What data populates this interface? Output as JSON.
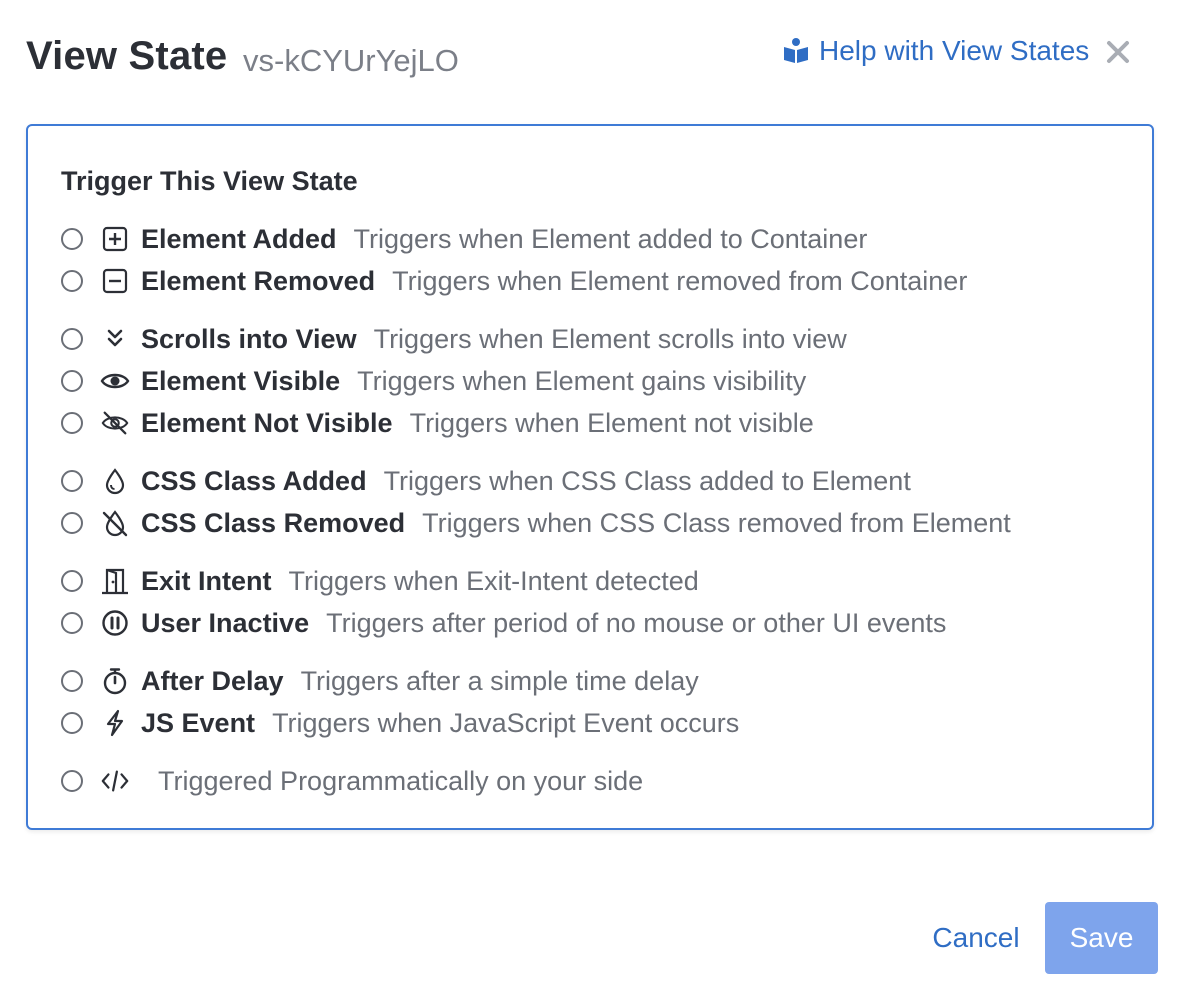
{
  "dialog": {
    "title": "View State",
    "subtitle": "vs-kCYUrYejLO",
    "help_link": "Help with View States",
    "close_icon": "close-icon"
  },
  "panel": {
    "title": "Trigger This View State",
    "options": [
      {
        "icon": "plus-square-icon",
        "label": "Element Added",
        "desc": "Triggers when Element added to Container"
      },
      {
        "icon": "minus-square-icon",
        "label": "Element Removed",
        "desc": "Triggers when Element removed from Container"
      },
      {
        "icon": "chevrons-down-icon",
        "label": "Scrolls into View",
        "desc": "Triggers when Element scrolls into view"
      },
      {
        "icon": "eye-icon",
        "label": "Element Visible",
        "desc": "Triggers when Element gains visibility"
      },
      {
        "icon": "eye-slash-icon",
        "label": "Element Not Visible",
        "desc": "Triggers when Element not visible"
      },
      {
        "icon": "droplet-icon",
        "label": "CSS Class Added",
        "desc": "Triggers when CSS Class added to Element"
      },
      {
        "icon": "droplet-slash-icon",
        "label": "CSS Class Removed",
        "desc": "Triggers when CSS Class removed from Element"
      },
      {
        "icon": "door-exit-icon",
        "label": "Exit Intent",
        "desc": "Triggers when Exit-Intent detected"
      },
      {
        "icon": "pause-circle-icon",
        "label": "User Inactive",
        "desc": "Triggers after period of no mouse or other UI events"
      },
      {
        "icon": "stopwatch-icon",
        "label": "After Delay",
        "desc": "Triggers after a simple time delay"
      },
      {
        "icon": "bolt-icon",
        "label": "JS Event",
        "desc": "Triggers when JavaScript Event occurs"
      },
      {
        "icon": "code-icon",
        "label": "",
        "desc": "Triggered Programmatically on your side"
      }
    ]
  },
  "footer": {
    "cancel_label": "Cancel",
    "save_label": "Save"
  },
  "colors": {
    "accent": "#2f6dc4",
    "panel_border": "#3f7bd6",
    "save_bg": "#7ea4ec"
  }
}
